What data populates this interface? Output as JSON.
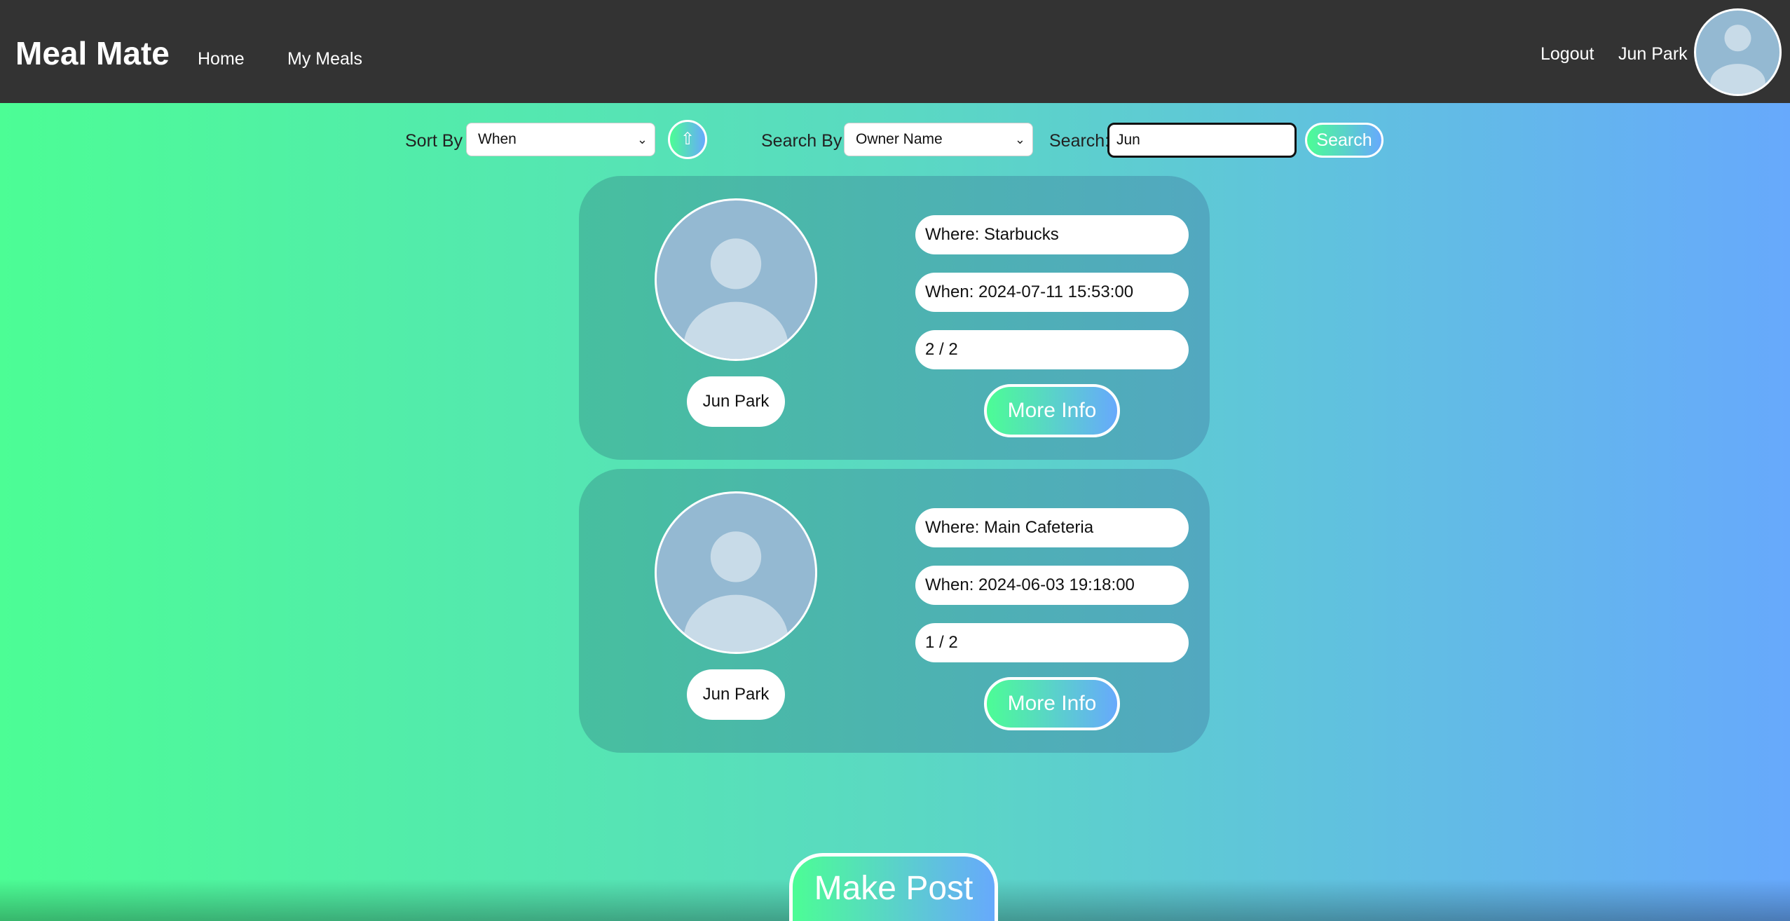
{
  "app": {
    "brand": "Meal Mate"
  },
  "nav": {
    "home": "Home",
    "my_meals": "My Meals",
    "logout": "Logout",
    "user_name": "Jun Park",
    "avatar_icon": "user-avatar-icon"
  },
  "controls": {
    "sort_label": "Sort By",
    "sort_value": "When",
    "sort_direction_glyph": "⇧",
    "search_by_label": "Search By",
    "search_by_value": "Owner Name",
    "search_label": "Search:",
    "search_value": "Jun",
    "search_button": "Search"
  },
  "meals": [
    {
      "owner": "Jun Park",
      "where": "Where: Starbucks",
      "when": "When: 2024-07-11 15:53:00",
      "count": "2 / 2",
      "more_info": "More Info"
    },
    {
      "owner": "Jun Park",
      "where": "Where: Main Cafeteria",
      "when": "When: 2024-06-03 19:18:00",
      "count": "1 / 2",
      "more_info": "More Info"
    }
  ],
  "make_post": "Make Post",
  "colors": {
    "navbar": "#333333",
    "gradient_start": "#4cfd95",
    "gradient_end": "#67a9fc",
    "card": "#4db6ad",
    "avatar_bg": "#94b9d2"
  }
}
